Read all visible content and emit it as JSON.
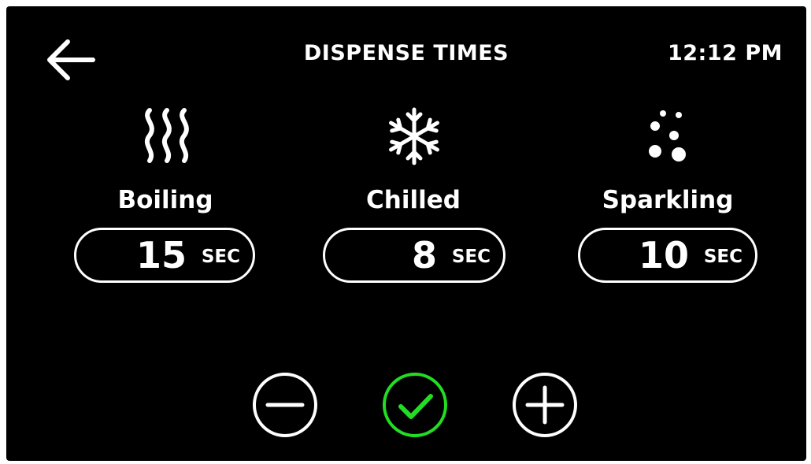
{
  "header": {
    "title": "DISPENSE TIMES",
    "time": "12:12 PM"
  },
  "options": [
    {
      "label": "Boiling",
      "value": "15",
      "unit": "SEC",
      "icon": "steam-icon"
    },
    {
      "label": "Chilled",
      "value": "8",
      "unit": "SEC",
      "icon": "snowflake-icon"
    },
    {
      "label": "Sparkling",
      "value": "10",
      "unit": "SEC",
      "icon": "bubbles-icon"
    }
  ],
  "controls": {
    "decrease_icon": "minus-icon",
    "confirm_icon": "check-icon",
    "increase_icon": "plus-icon"
  },
  "colors": {
    "background": "#000000",
    "foreground": "#ffffff",
    "confirm_accent": "#22dd22"
  }
}
